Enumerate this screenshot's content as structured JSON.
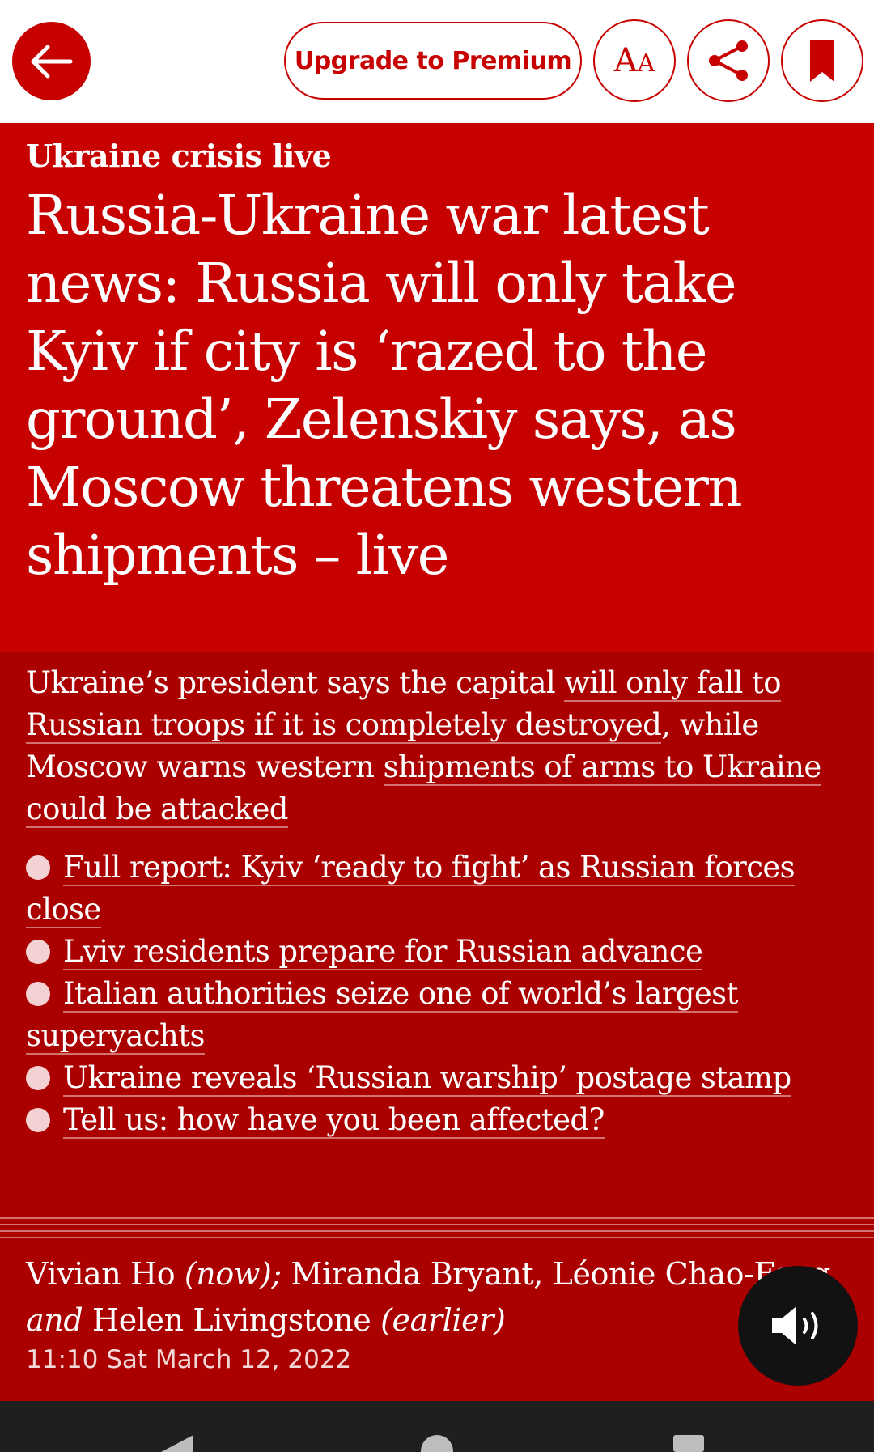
{
  "toolbar": {
    "back_icon": "arrow-left-icon",
    "premium_label": "Upgrade to Premium",
    "font_icon": "text-size-icon",
    "share_icon": "share-icon",
    "bookmark_icon": "bookmark-icon",
    "accent_color": "#c70000"
  },
  "article": {
    "kicker": "Ukraine crisis live",
    "headline": "Russia-Ukraine war latest news: Russia will only take Kyiv if city is ‘razed to the ground’, Zelenskiy says, as Moscow threatens western shipments – live",
    "standfirst": {
      "part1": "Ukraine’s president says the capital ",
      "link1": "will only fall to Russian troops if it is completely destroyed",
      "part2": ", while Moscow warns western ",
      "link2": "shipments of arms to Ukraine could be attacked"
    },
    "bullets": [
      {
        "text": "Full report: Kyiv ‘ready to fight’ as Russian forces close"
      },
      {
        "text": "Lviv residents prepare for Russian advance"
      },
      {
        "text": "Italian authorities seize one of world’s largest superyachts"
      },
      {
        "text": "Ukraine reveals ‘Russian warship’ postage stamp"
      },
      {
        "text": "Tell us: how have you been affected?"
      }
    ],
    "byline": {
      "author_now": "Vivian Ho",
      "now_label": "(now);",
      "authors_earlier": "Miranda Bryant, Léonie Chao-Fong",
      "and_label": "and",
      "author_last": "Helen Livingstone",
      "earlier_label": "(earlier)"
    },
    "timestamp": "11:10 Sat March 12, 2022",
    "background_color": "#ab0000"
  },
  "listen_button": {
    "icon": "speaker-icon"
  },
  "system_nav": {
    "back_icon": "nav-back-icon",
    "home_icon": "nav-home-icon",
    "recents_icon": "nav-recents-icon"
  }
}
